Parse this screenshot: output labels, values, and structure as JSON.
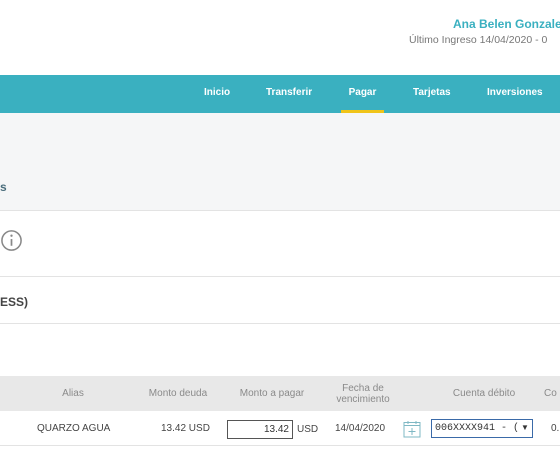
{
  "header": {
    "user_name": "Ana Belen Gonzale",
    "last_login": "Último Ingreso 14/04/2020 - 0"
  },
  "nav": {
    "items": [
      {
        "label": "Inicio"
      },
      {
        "label": "Transferir"
      },
      {
        "label": "Pagar",
        "active": true
      },
      {
        "label": "Tarjetas"
      },
      {
        "label": "Inversiones"
      }
    ]
  },
  "section": {
    "title": "s",
    "row3_text": "ESS)"
  },
  "table": {
    "headers": [
      "Alias",
      "Monto deuda",
      "Monto a pagar",
      "Fecha de vencimiento",
      "Cuenta débito",
      "Co"
    ],
    "rows": [
      {
        "alias": "QUARZO AGUA",
        "debt": "13.42 USD",
        "pay_amount": "13.42",
        "pay_unit": "USD",
        "due_date": "14/04/2020",
        "account": "006XXXX941 - (",
        "extra": "0."
      }
    ]
  },
  "icons": {
    "info": "info-circle-icon",
    "calendar": "calendar-add-icon",
    "dropdown": "chevron-down-icon"
  },
  "colors": {
    "brand": "#3ab0c0",
    "active_tab_underline": "#f0c419",
    "table_header_bg": "#e8e8e8"
  }
}
